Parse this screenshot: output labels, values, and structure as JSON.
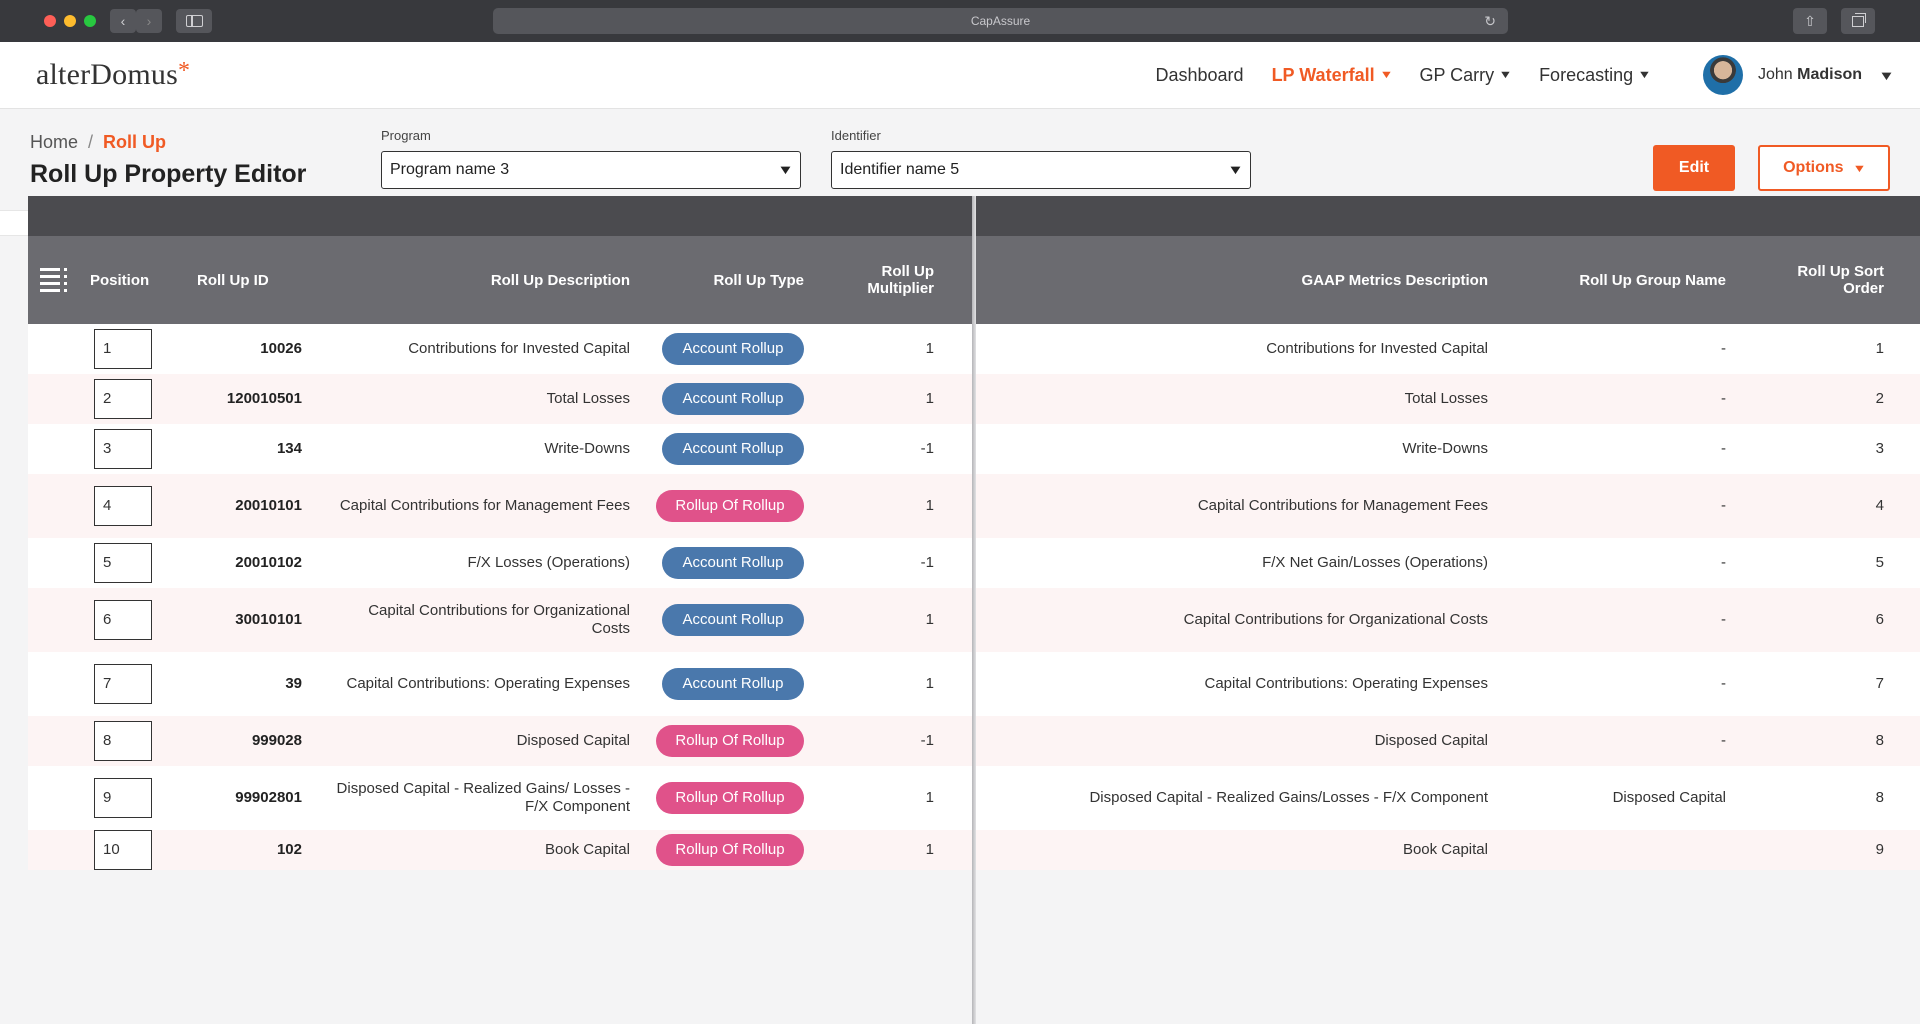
{
  "browser": {
    "address": "CapAssure",
    "back": "‹",
    "forward": "›",
    "share": "⇧"
  },
  "app": {
    "logo": "alterDomus",
    "logo_mark": "*"
  },
  "nav": [
    {
      "label": "Dashboard",
      "dropdown": false,
      "active": false
    },
    {
      "label": "LP Waterfall",
      "dropdown": true,
      "active": true
    },
    {
      "label": "GP Carry",
      "dropdown": true,
      "active": false
    },
    {
      "label": "Forecasting",
      "dropdown": true,
      "active": false
    }
  ],
  "user": {
    "first": "John",
    "last": "Madison"
  },
  "breadcrumb": {
    "home": "Home",
    "separator": "/",
    "current": "Roll Up"
  },
  "page_title": "Roll Up Property Editor",
  "filters": {
    "program_label": "Program",
    "program_value": "Program name 3",
    "identifier_label": "Identifier",
    "identifier_value": "Identifier name 5"
  },
  "buttons": {
    "edit": "Edit",
    "options": "Options"
  },
  "columns": {
    "position": "Position",
    "id": "Roll Up ID",
    "desc": "Roll Up Description",
    "type": "Roll Up Type",
    "mult": "Roll Up Multiplier",
    "gaap": "GAAP Metrics Description",
    "group": "Roll Up Group Name",
    "sort": "Roll Up Sort Order"
  },
  "accent_color": "#f05a24",
  "rows": [
    {
      "position": "1",
      "id": "10026",
      "desc": "Contributions for Invested Capital",
      "type": "Account Rollup",
      "kind": "acc",
      "mult": "1",
      "gaap": "Contributions for Invested Capital",
      "group": "-",
      "sort": "1"
    },
    {
      "position": "2",
      "id": "120010501",
      "desc": "Total Losses",
      "type": "Account Rollup",
      "kind": "acc",
      "mult": "1",
      "gaap": "Total Losses",
      "group": "-",
      "sort": "2"
    },
    {
      "position": "3",
      "id": "134",
      "desc": "Write-Downs",
      "type": "Account Rollup",
      "kind": "acc",
      "mult": "-1",
      "gaap": "Write-Downs",
      "group": "-",
      "sort": "3"
    },
    {
      "position": "4",
      "id": "20010101",
      "desc": "Capital Contributions for Management Fees",
      "type": "Rollup Of Rollup",
      "kind": "rur",
      "mult": "1",
      "gaap": "Capital Contributions for Management Fees",
      "group": "-",
      "sort": "4"
    },
    {
      "position": "5",
      "id": "20010102",
      "desc": "F/X Losses (Operations)",
      "type": "Account Rollup",
      "kind": "acc",
      "mult": "-1",
      "gaap": "F/X Net Gain/Losses (Operations)",
      "group": "-",
      "sort": "5"
    },
    {
      "position": "6",
      "id": "30010101",
      "desc": "Capital Contributions for Organizational Costs",
      "type": "Account Rollup",
      "kind": "acc",
      "mult": "1",
      "gaap": "Capital Contributions for Organizational Costs",
      "group": "-",
      "sort": "6"
    },
    {
      "position": "7",
      "id": "39",
      "desc": "Capital Contributions: Operating Expenses",
      "type": "Account Rollup",
      "kind": "acc",
      "mult": "1",
      "gaap": "Capital Contributions: Operating Expenses",
      "group": "-",
      "sort": "7"
    },
    {
      "position": "8",
      "id": "999028",
      "desc": "Disposed Capital",
      "type": "Rollup Of Rollup",
      "kind": "rur",
      "mult": "-1",
      "gaap": "Disposed Capital",
      "group": "-",
      "sort": "8"
    },
    {
      "position": "9",
      "id": "99902801",
      "desc": "Disposed Capital - Realized Gains/ Losses - F/X Component",
      "type": "Rollup Of Rollup",
      "kind": "rur",
      "mult": "1",
      "gaap": "Disposed Capital - Realized Gains/Losses - F/X Component",
      "group": "Disposed Capital",
      "sort": "8"
    },
    {
      "position": "10",
      "id": "102",
      "desc": "Book Capital",
      "type": "Rollup Of Rollup",
      "kind": "rur",
      "mult": "1",
      "gaap": "Book Capital",
      "group": "",
      "sort": "9"
    }
  ]
}
